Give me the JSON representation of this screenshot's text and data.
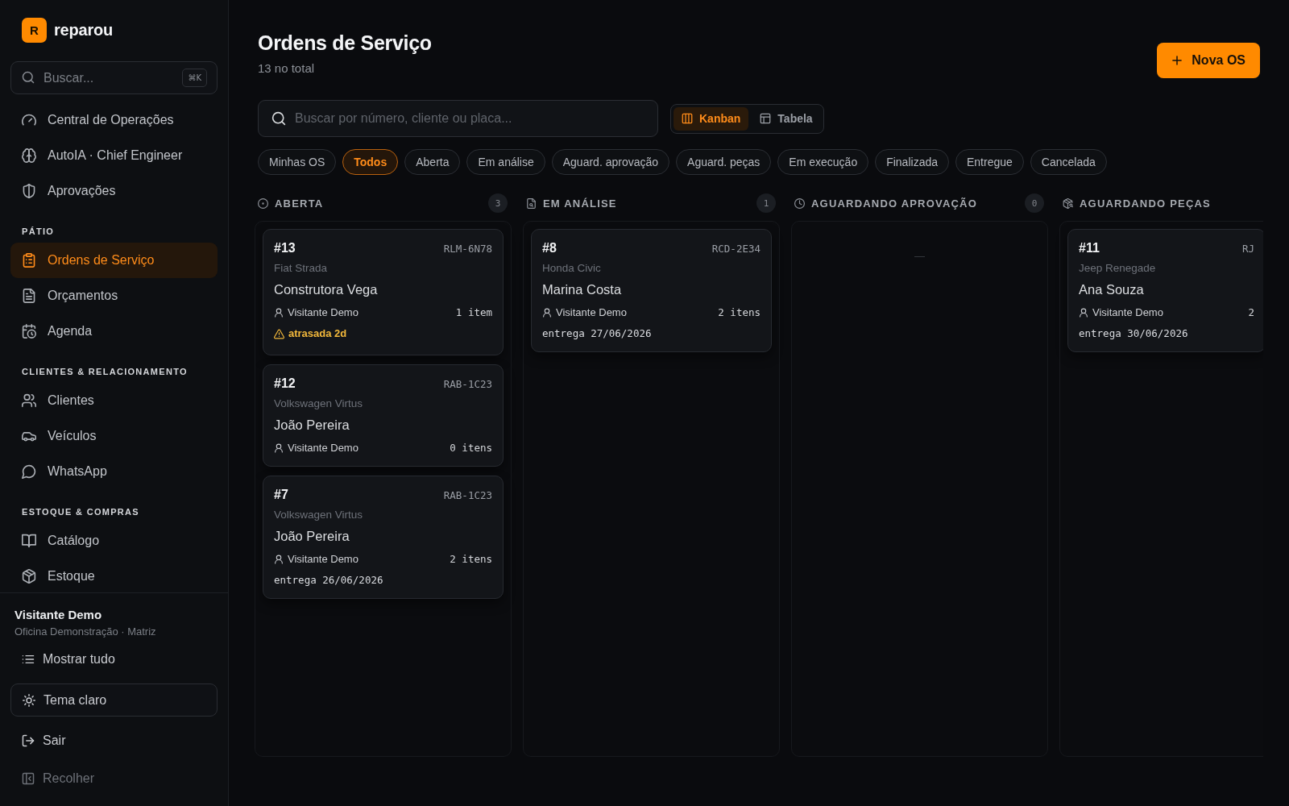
{
  "sidebar": {
    "logo": {
      "mark": "R",
      "name": "reparou"
    },
    "search": {
      "placeholder": "Buscar...",
      "shortcut": "⌘K"
    },
    "sections": [
      {
        "items": [
          {
            "label": "Central de Operações",
            "selected": false
          },
          {
            "label": "AutoIA · Chief Engineer",
            "selected": false
          },
          {
            "label": "Aprovações",
            "selected": false
          }
        ]
      },
      {
        "title": "PÁTIO",
        "items": [
          {
            "label": "Ordens de Serviço",
            "selected": true
          },
          {
            "label": "Orçamentos",
            "selected": false
          },
          {
            "label": "Agenda",
            "selected": false
          }
        ]
      },
      {
        "title": "CLIENTES & RELACIONAMENTO",
        "items": [
          {
            "label": "Clientes",
            "selected": false
          },
          {
            "label": "Veículos",
            "selected": false
          },
          {
            "label": "WhatsApp",
            "selected": false
          }
        ]
      },
      {
        "title": "ESTOQUE & COMPRAS",
        "items": [
          {
            "label": "Catálogo",
            "selected": false
          },
          {
            "label": "Estoque",
            "selected": false
          }
        ]
      }
    ],
    "user": {
      "name": "Visitante Demo",
      "workspace": "Oficina Demonstração · Matriz"
    },
    "actions": [
      {
        "kind": "plain",
        "label": "Mostrar tudo"
      },
      {
        "kind": "outlined",
        "label": "Tema claro"
      },
      {
        "kind": "plain",
        "label": "Sair"
      },
      {
        "kind": "muted",
        "label": "Recolher"
      }
    ]
  },
  "header": {
    "title": "Ordens de Serviço",
    "subtitle": "13 no total",
    "primary_button": "Nova OS"
  },
  "search": {
    "placeholder": "Buscar por número, cliente ou placa..."
  },
  "view_tabs": [
    {
      "label": "Kanban",
      "selected": true
    },
    {
      "label": "Tabela",
      "selected": false
    }
  ],
  "filters": [
    {
      "label": "Minhas OS",
      "selected": false
    },
    {
      "label": "Todos",
      "selected": true
    },
    {
      "label": "Aberta",
      "selected": false
    },
    {
      "label": "Em análise",
      "selected": false
    },
    {
      "label": "Aguard. aprovação",
      "selected": false
    },
    {
      "label": "Aguard. peças",
      "selected": false
    },
    {
      "label": "Em execução",
      "selected": false
    },
    {
      "label": "Finalizada",
      "selected": false
    },
    {
      "label": "Entregue",
      "selected": false
    },
    {
      "label": "Cancelada",
      "selected": false
    }
  ],
  "board": {
    "columns": [
      {
        "title": "ABERTA",
        "count": "3",
        "cards": [
          {
            "number": "#13",
            "plate": "RLM-6N78",
            "vehicle": "Fiat Strada",
            "client": "Construtora Vega",
            "assignee": "Visitante Demo",
            "items": "1 item",
            "late": "atrasada 2d"
          },
          {
            "number": "#12",
            "plate": "RAB-1C23",
            "vehicle": "Volkswagen Virtus",
            "client": "João Pereira",
            "assignee": "Visitante Demo",
            "items": "0 itens"
          },
          {
            "number": "#7",
            "plate": "RAB-1C23",
            "vehicle": "Volkswagen Virtus",
            "client": "João Pereira",
            "assignee": "Visitante Demo",
            "items": "2 itens",
            "delivery": "entrega 26/06/2026"
          }
        ]
      },
      {
        "title": "EM ANÁLISE",
        "count": "1",
        "cards": [
          {
            "number": "#8",
            "plate": "RCD-2E34",
            "vehicle": "Honda Civic",
            "client": "Marina Costa",
            "assignee": "Visitante Demo",
            "items": "2 itens",
            "delivery": "entrega 27/06/2026"
          }
        ]
      },
      {
        "title": "AGUARDANDO APROVAÇÃO",
        "count": "0",
        "empty": "—"
      },
      {
        "title": "AGUARDANDO PEÇAS",
        "cards": [
          {
            "number": "#11",
            "plate": "RJ",
            "vehicle": "Jeep Renegade",
            "client": "Ana Souza",
            "assignee": "Visitante Demo",
            "items": "2",
            "delivery": "entrega 30/06/2026"
          }
        ]
      }
    ]
  }
}
